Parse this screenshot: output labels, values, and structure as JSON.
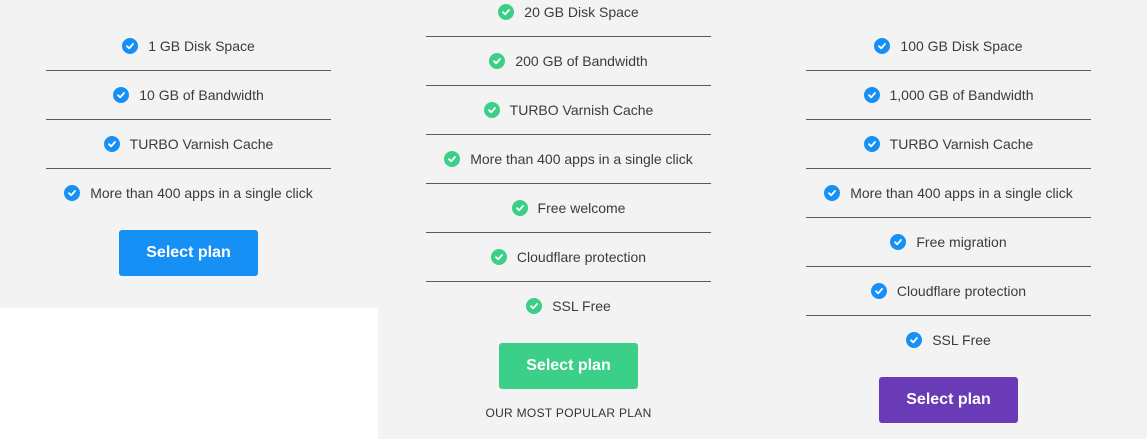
{
  "colors": {
    "blue": "#1790f5",
    "green": "#3ccf87",
    "purple": "#6a3bb7"
  },
  "icons": {
    "feature_check": "check-circle-icon"
  },
  "plans": [
    {
      "features": [
        "1 GB Disk Space",
        "10 GB of Bandwidth",
        "TURBO Varnish Cache",
        "More than 400 apps in a single click"
      ],
      "button_label": "Select plan"
    },
    {
      "features": [
        "20 GB Disk Space",
        "200 GB of Bandwidth",
        "TURBO Varnish Cache",
        "More than 400 apps in a single click",
        "Free welcome",
        "Cloudflare protection",
        "SSL Free"
      ],
      "button_label": "Select plan",
      "note": "OUR MOST POPULAR PLAN"
    },
    {
      "features": [
        "100 GB Disk Space",
        "1,000 GB of Bandwidth",
        "TURBO Varnish Cache",
        "More than 400 apps in a single click",
        "Free migration",
        "Cloudflare protection",
        "SSL Free"
      ],
      "button_label": "Select plan"
    }
  ]
}
